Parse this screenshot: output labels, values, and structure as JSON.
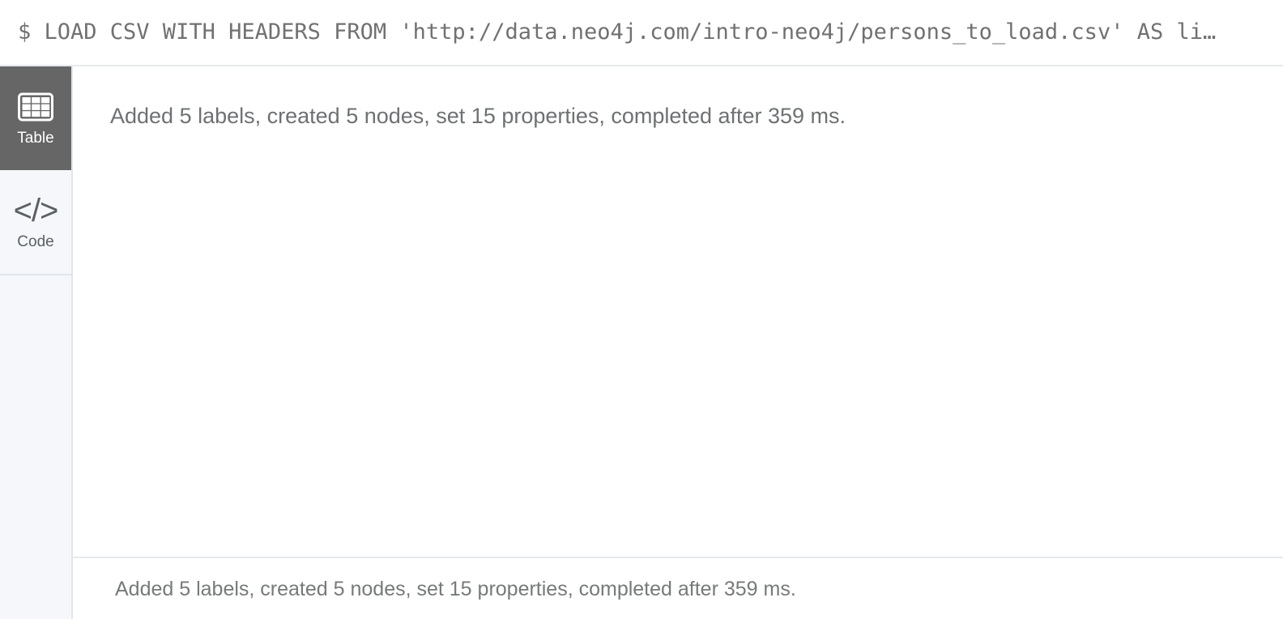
{
  "query_bar": {
    "prompt": "$",
    "command": "LOAD CSV WITH HEADERS FROM 'http://data.neo4j.com/intro-neo4j/persons_to_load.csv' AS li…",
    "full_text": "$ LOAD CSV WITH HEADERS FROM 'http://data.neo4j.com/intro-neo4j/persons_to_load.csv' AS li…",
    "text_color": "#717171"
  },
  "sidebar": {
    "items": [
      {
        "id": "table",
        "label": "Table",
        "icon": "table-grid-icon",
        "active": true,
        "active_bg": "#666666",
        "active_fg": "#ffffff"
      },
      {
        "id": "code",
        "label": "Code",
        "icon": "code-angle-brackets-icon",
        "icon_glyph": "</>",
        "active": false
      }
    ],
    "background": "#f5f7fa",
    "border_color": "#e1e5ec"
  },
  "result": {
    "message": "Added 5 labels, created 5 nodes, set 15 properties, completed after 359 ms.",
    "message_color": "#6e7173",
    "stats": {
      "labels_added": 5,
      "nodes_created": 5,
      "properties_set": 15,
      "completed_after_ms": 359
    }
  },
  "footer": {
    "message": "Added 5 labels, created 5 nodes, set 15 properties, completed after 359 ms.",
    "message_color": "#77797b"
  }
}
